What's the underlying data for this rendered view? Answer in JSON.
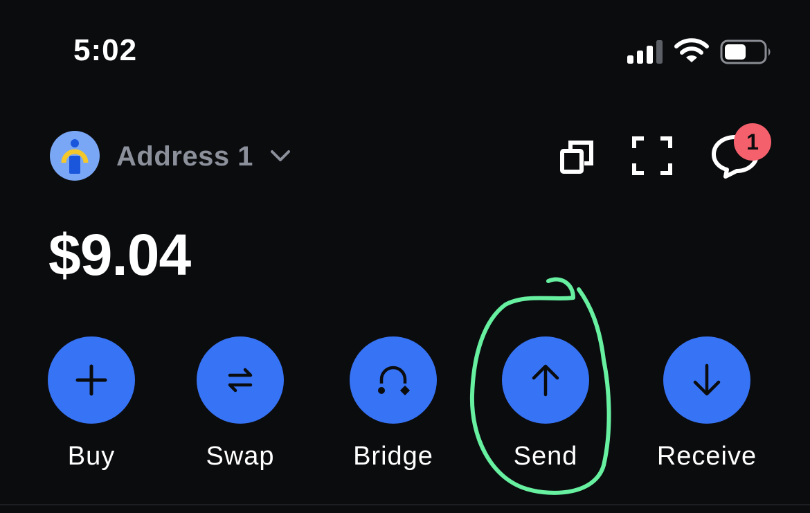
{
  "status_bar": {
    "time": "5:02",
    "icons": [
      "cellular-signal-icon",
      "wifi-icon",
      "battery-icon"
    ]
  },
  "header": {
    "address_label": "Address 1",
    "notification_count": "1",
    "icons": [
      "avatar",
      "chevron-down-icon",
      "copy-icon",
      "qr-scan-icon",
      "chat-icon"
    ]
  },
  "balance": "$9.04",
  "actions": [
    {
      "label": "Buy",
      "icon": "plus-icon"
    },
    {
      "label": "Swap",
      "icon": "swap-arrows-icon"
    },
    {
      "label": "Bridge",
      "icon": "bridge-icon"
    },
    {
      "label": "Send",
      "icon": "arrow-up-icon"
    },
    {
      "label": "Receive",
      "icon": "arrow-down-icon"
    }
  ],
  "colors": {
    "background": "#0b0c0e",
    "accent": "#3773f5",
    "badge": "#f4606c",
    "muted_text": "#8b909b",
    "annotation": "#66f0a0"
  }
}
